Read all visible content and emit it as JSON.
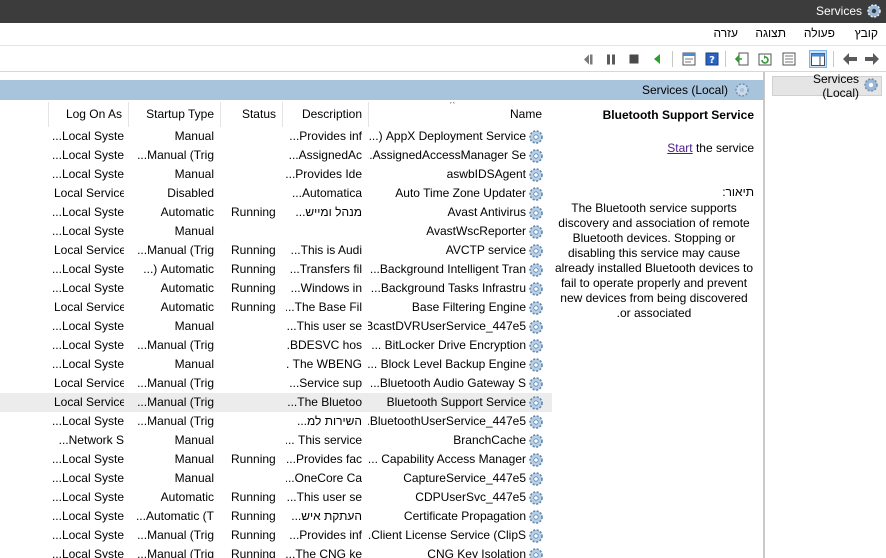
{
  "window": {
    "title": "Services",
    "icon": "gear-icon"
  },
  "menu": {
    "items": [
      "קובץ",
      "פעולה",
      "תצוגה",
      "עזרה"
    ]
  },
  "toolbar": {
    "icons": [
      "back-arrow-icon",
      "forward-arrow-icon",
      "show-hide-tree-icon",
      "properties-icon",
      "refresh-icon",
      "export-list-icon",
      "help-icon",
      "console-icon",
      "start-service-icon",
      "stop-service-icon",
      "pause-service-icon",
      "restart-service-icon"
    ]
  },
  "tree": {
    "selected_label": "Services (Local)"
  },
  "main": {
    "header": "Services (Local)"
  },
  "details": {
    "service_title": "Bluetooth Support Service",
    "start_link": "Start",
    "start_suffix": "the service",
    "description_label": "תיאור:",
    "description": "The Bluetooth service supports discovery and association of remote Bluetooth devices.  Stopping or disabling this service may cause already installed Bluetooth devices to fail to operate properly and prevent new devices from being discovered or associated."
  },
  "columns": {
    "name": "Name",
    "description": "Description",
    "status": "Status",
    "startup_type": "Startup Type",
    "log_on_as": "Log On As"
  },
  "services": [
    {
      "name": "AppX Deployment Service (...",
      "description": "Provides inf...",
      "status": "",
      "startup": "Manual",
      "logon": "Local Syste..."
    },
    {
      "name": "AssignedAccessManager Se...",
      "description": "AssignedAc...",
      "status": "",
      "startup": "Manual (Trig...",
      "logon": "Local Syste..."
    },
    {
      "name": "aswbIDSAgent",
      "description": "Provides Ide...",
      "status": "",
      "startup": "Manual",
      "logon": "Local Syste..."
    },
    {
      "name": "Auto Time Zone Updater",
      "description": "Automatica...",
      "status": "",
      "startup": "Disabled",
      "logon": "Local Service"
    },
    {
      "name": "Avast Antivirus",
      "description": "מנהל ומייש...",
      "status": "Running",
      "startup": "Automatic",
      "logon": "Local Syste..."
    },
    {
      "name": "AvastWscReporter",
      "description": "",
      "status": "",
      "startup": "Manual",
      "logon": "Local Syste..."
    },
    {
      "name": "AVCTP service",
      "description": "This is Audi...",
      "status": "Running",
      "startup": "Manual (Trig...",
      "logon": "Local Service"
    },
    {
      "name": "Background Intelligent Tran...",
      "description": "Transfers fil...",
      "status": "Running",
      "startup": "Automatic (...",
      "logon": "Local Syste..."
    },
    {
      "name": "Background Tasks Infrastru...",
      "description": "Windows in...",
      "status": "Running",
      "startup": "Automatic",
      "logon": "Local Syste..."
    },
    {
      "name": "Base Filtering Engine",
      "description": "The Base Fil...",
      "status": "Running",
      "startup": "Automatic",
      "logon": "Local Service"
    },
    {
      "name": "BcastDVRUserService_447e5...",
      "description": "This user se...",
      "status": "",
      "startup": "Manual",
      "logon": "Local Syste..."
    },
    {
      "name": "BitLocker Drive Encryption ...",
      "description": "BDESVC hos...",
      "status": "",
      "startup": "Manual (Trig...",
      "logon": "Local Syste..."
    },
    {
      "name": "Block Level Backup Engine ...",
      "description": "The WBENG ...",
      "status": "",
      "startup": "Manual",
      "logon": "Local Syste..."
    },
    {
      "name": "Bluetooth Audio Gateway S...",
      "description": "Service sup...",
      "status": "",
      "startup": "Manual (Trig...",
      "logon": "Local Service"
    },
    {
      "name": "Bluetooth Support Service",
      "description": "The Bluetoo...",
      "status": "",
      "startup": "Manual (Trig...",
      "logon": "Local Service"
    },
    {
      "name": "BluetoothUserService_447e5...",
      "description": "השירות למ...",
      "status": "",
      "startup": "Manual (Trig...",
      "logon": "Local Syste..."
    },
    {
      "name": "BranchCache",
      "description": "This service ...",
      "status": "",
      "startup": "Manual",
      "logon": "Network S..."
    },
    {
      "name": "Capability Access Manager ...",
      "description": "Provides fac...",
      "status": "Running",
      "startup": "Manual",
      "logon": "Local Syste..."
    },
    {
      "name": "CaptureService_447e5",
      "description": "OneCore Ca...",
      "status": "",
      "startup": "Manual",
      "logon": "Local Syste..."
    },
    {
      "name": "CDPUserSvc_447e5",
      "description": "This user se...",
      "status": "Running",
      "startup": "Automatic",
      "logon": "Local Syste..."
    },
    {
      "name": "Certificate Propagation",
      "description": "העתקת איש...",
      "status": "Running",
      "startup": "Automatic (T...",
      "logon": "Local Syste..."
    },
    {
      "name": "Client License Service (ClipS...",
      "description": "Provides inf...",
      "status": "Running",
      "startup": "Manual (Trig...",
      "logon": "Local Syste..."
    },
    {
      "name": "CNG Key Isolation",
      "description": "The CNG ke...",
      "status": "Running",
      "startup": "Manual (Trig...",
      "logon": "Local Syste..."
    }
  ],
  "selected_service": "Bluetooth Support Service"
}
